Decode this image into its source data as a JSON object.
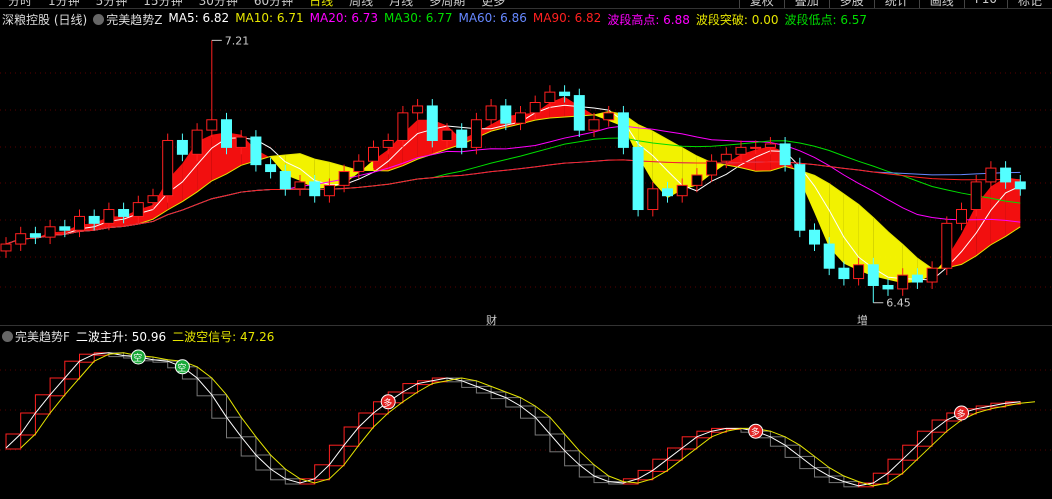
{
  "tabs": [
    "分时",
    "1分钟",
    "5分钟",
    "15分钟",
    "30分钟",
    "60分钟",
    "日线",
    "周线",
    "月线",
    "多周期",
    "更多"
  ],
  "active_tab": "日线",
  "right_buttons": [
    "复权",
    "叠加",
    "多股",
    "统计",
    "画线",
    "F10",
    "标记"
  ],
  "main_legend": {
    "title": "深粮控股 (日线)",
    "indicator": "完美趋势Z",
    "items": [
      {
        "label": "MA5: 6.82",
        "color": "#ffffff"
      },
      {
        "label": "MA10: 6.71",
        "color": "#e6e600"
      },
      {
        "label": "MA20: 6.73",
        "color": "#ff00ff"
      },
      {
        "label": "MA30: 6.77",
        "color": "#00dd00"
      },
      {
        "label": "MA60: 6.86",
        "color": "#6688ff"
      },
      {
        "label": "MA90: 6.82",
        "color": "#ff2020"
      },
      {
        "label": "波段高点: 6.88",
        "color": "#ff00ff"
      },
      {
        "label": "波段突破: 0.00",
        "color": "#e6e600"
      },
      {
        "label": "波段低点: 6.57",
        "color": "#00dd00"
      }
    ]
  },
  "sub_legend": {
    "indicator": "完美趋势F",
    "items": [
      {
        "label": "二波主升: 50.96",
        "color": "#ffffff"
      },
      {
        "label": "二波空信号: 47.26",
        "color": "#e6e600"
      }
    ]
  },
  "markers": {
    "high_label": "7.21",
    "low_label": "6.45",
    "event1": "财",
    "event2": "增",
    "short_signal": "空",
    "long_signal": "多"
  },
  "colors": {
    "up": "#ff2020",
    "down": "#54ffff",
    "bg": "#000000"
  },
  "chart_data": {
    "type": "candlestick",
    "price_range": [
      6.4,
      7.24
    ],
    "closes": [
      6.62,
      6.65,
      6.64,
      6.67,
      6.66,
      6.7,
      6.68,
      6.72,
      6.7,
      6.74,
      6.76,
      6.92,
      6.88,
      6.95,
      6.98,
      6.9,
      6.93,
      6.85,
      6.83,
      6.78,
      6.8,
      6.76,
      6.79,
      6.83,
      6.86,
      6.9,
      6.92,
      7.0,
      7.02,
      6.92,
      6.95,
      6.9,
      6.98,
      7.02,
      6.97,
      7.0,
      7.03,
      7.06,
      7.05,
      6.95,
      6.98,
      7.0,
      6.9,
      6.72,
      6.78,
      6.76,
      6.79,
      6.82,
      6.86,
      6.88,
      6.9,
      6.9,
      6.91,
      6.85,
      6.66,
      6.62,
      6.55,
      6.52,
      6.56,
      6.5,
      6.49,
      6.53,
      6.51,
      6.55,
      6.68,
      6.72,
      6.8,
      6.84,
      6.8,
      6.78
    ],
    "high_index": 14,
    "high_value": 7.21,
    "low_index": 59,
    "low_value": 6.45,
    "short_signal_indices": [
      9,
      12
    ],
    "long_signal_indices": [
      26,
      51,
      65
    ],
    "oscillator": {
      "range": [
        0,
        100
      ],
      "white": [
        30,
        40,
        55,
        68,
        80,
        92,
        97,
        98,
        96,
        95,
        93,
        92,
        88,
        80,
        68,
        52,
        38,
        25,
        15,
        8,
        5,
        8,
        18,
        32,
        45,
        55,
        63,
        70,
        76,
        78,
        80,
        78,
        74,
        70,
        66,
        60,
        52,
        40,
        28,
        18,
        10,
        6,
        5,
        8,
        14,
        22,
        30,
        38,
        42,
        44,
        44,
        42,
        38,
        32,
        24,
        16,
        10,
        6,
        3,
        5,
        12,
        22,
        32,
        42,
        50,
        55,
        58,
        60,
        62,
        63
      ],
      "yellow_lag": 1
    }
  }
}
